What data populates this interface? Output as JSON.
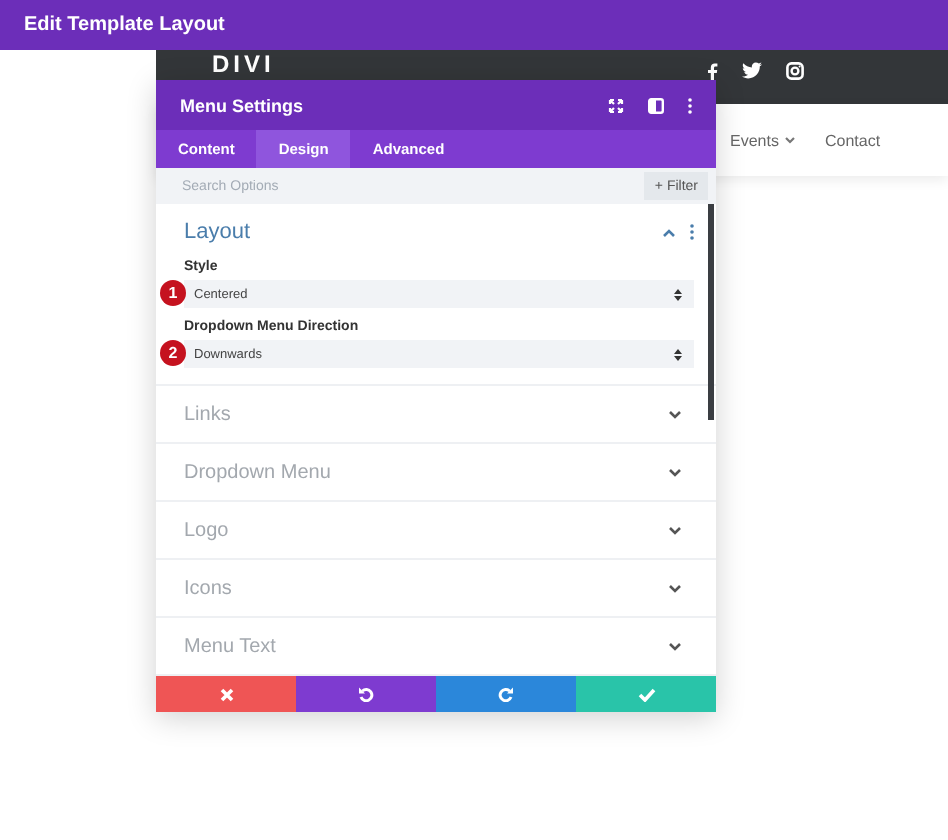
{
  "top_bar": {
    "title": "Edit Template Layout"
  },
  "site_header": {
    "logo": "DIVI"
  },
  "site_nav": {
    "items": [
      {
        "label": "Events",
        "has_dropdown": true
      },
      {
        "label": "Contact",
        "has_dropdown": false
      }
    ]
  },
  "modal": {
    "title": "Menu Settings",
    "tabs": [
      {
        "label": "Content",
        "selected": false
      },
      {
        "label": "Design",
        "selected": true
      },
      {
        "label": "Advanced",
        "selected": false
      }
    ],
    "search": {
      "placeholder": "Search Options"
    },
    "filter_button": "+ Filter",
    "layout": {
      "title": "Layout",
      "expanded": true,
      "fields": [
        {
          "label": "Style",
          "value": "Centered",
          "badge": "1"
        },
        {
          "label": "Dropdown Menu Direction",
          "value": "Downwards",
          "badge": "2"
        }
      ]
    },
    "sections": [
      {
        "label": "Links",
        "expanded": false
      },
      {
        "label": "Dropdown Menu",
        "expanded": false
      },
      {
        "label": "Logo",
        "expanded": false
      },
      {
        "label": "Icons",
        "expanded": false
      },
      {
        "label": "Menu Text",
        "expanded": false
      }
    ],
    "actions": [
      {
        "kind": "discard"
      },
      {
        "kind": "undo"
      },
      {
        "kind": "redo"
      },
      {
        "kind": "save"
      }
    ]
  }
}
